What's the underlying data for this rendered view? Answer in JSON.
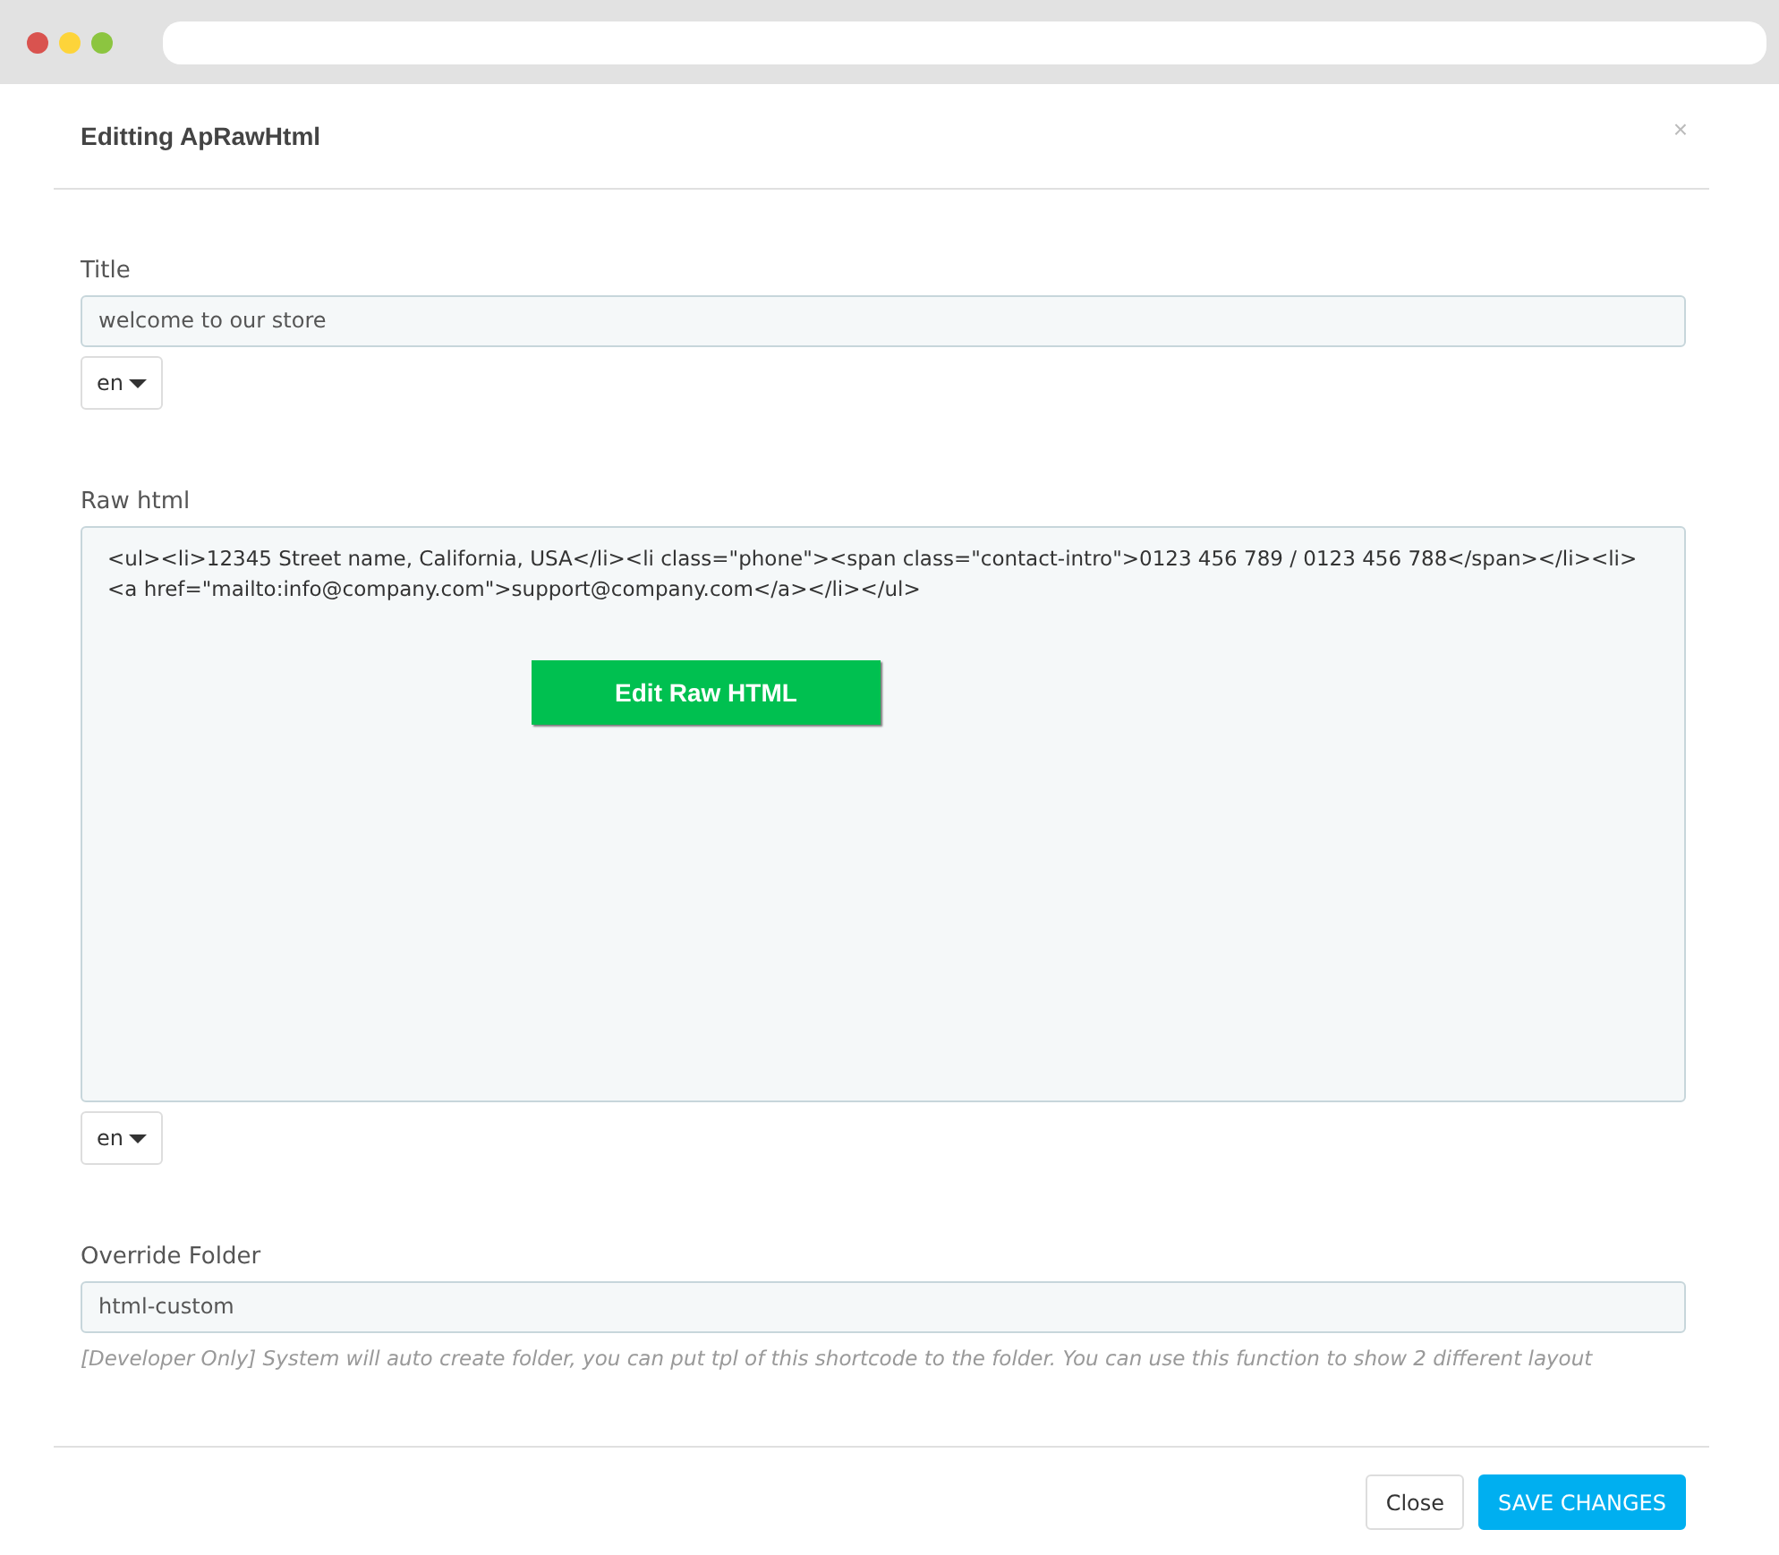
{
  "modal": {
    "title": "Editting ApRawHtml",
    "close": "×",
    "fields": [
      {
        "kind": "text",
        "label": "Title",
        "value": "welcome to our store",
        "language": "en"
      },
      {
        "kind": "textarea",
        "label": "Raw html",
        "value": "<ul><li>12345 Street name, California, USA</li><li class=\"phone\"><span class=\"contact-intro\">0123 456 789 / 0123 456 788</span></li><li><a href=\"mailto:info@company.com\">support@company.com</a></li></ul>",
        "language": "en",
        "overlay_button": "Edit Raw HTML"
      },
      {
        "kind": "text",
        "label": "Override Folder",
        "value": "html-custom",
        "help": "[Developer Only] System will auto create folder, you can put tpl of this shortcode to the folder. You can use this function to show 2 different layout"
      }
    ],
    "buttons": [
      {
        "label": "Close",
        "kind": "default"
      },
      {
        "label": "SAVE CHANGES",
        "kind": "primary"
      }
    ]
  }
}
